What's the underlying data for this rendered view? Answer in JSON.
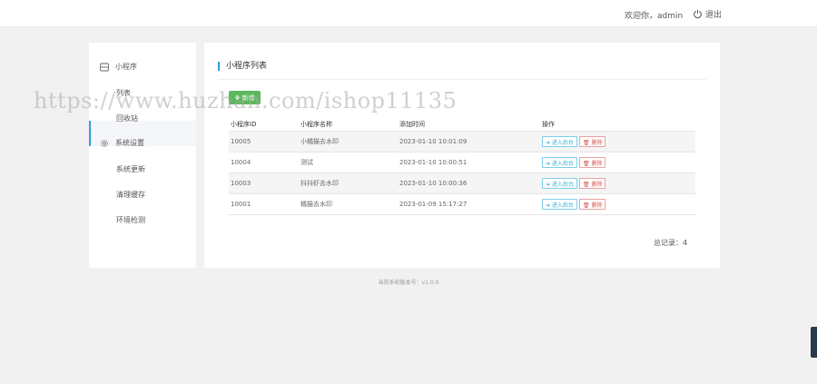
{
  "header": {
    "welcome": "欢迎你，admin",
    "logout_label": "退出"
  },
  "sidebar": {
    "groups": [
      {
        "label": "小程序",
        "icon": "window-icon"
      },
      {
        "label": "系统设置",
        "icon": "gear-icon"
      }
    ],
    "items": [
      {
        "label": "列表"
      },
      {
        "label": "回收站"
      },
      {
        "label": "系统更新"
      },
      {
        "label": "清理缓存"
      },
      {
        "label": "环境检测"
      }
    ]
  },
  "main": {
    "title": "小程序列表",
    "add_label": "✚ 新增",
    "columns": [
      "小程序ID",
      "小程序名称",
      "添加时间",
      "操作"
    ],
    "rows": [
      {
        "id": "10005",
        "name": "小橘猫去水印",
        "time": "2023-01-10 10:01:09"
      },
      {
        "id": "10004",
        "name": "测试",
        "time": "2023-01-10 10:00:51"
      },
      {
        "id": "10003",
        "name": "抖抖虾去水印",
        "time": "2023-01-10 10:00:36"
      },
      {
        "id": "10001",
        "name": "橘猫去水印",
        "time": "2023-01-09 15:17:27"
      }
    ],
    "enter_label": "➜ 进入后台",
    "delete_label": "🗑 删除",
    "total": "总记录：4"
  },
  "footer": {
    "version": "当前系统版本号：v1.0.0"
  },
  "watermark": "https://www.huzhan.com/ishop11135",
  "colors": {
    "accent": "#2f9fdb",
    "success": "#5cb85c",
    "danger": "#d9534f",
    "info": "#31b0d5"
  }
}
